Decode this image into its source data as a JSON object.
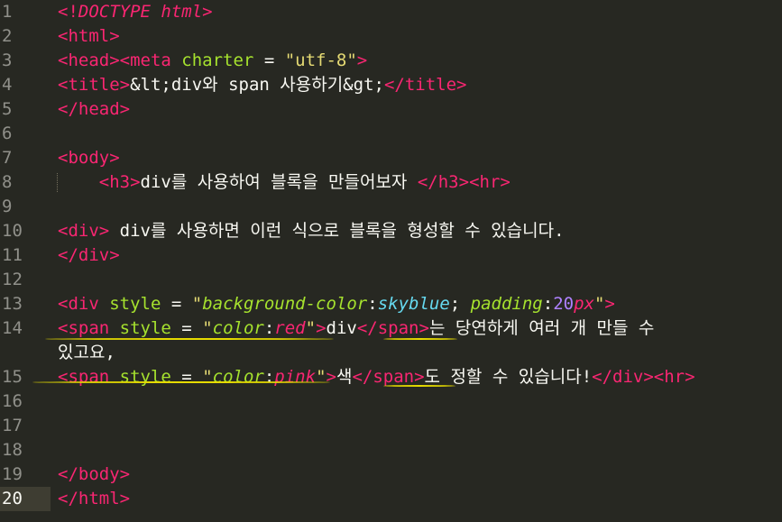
{
  "editor": {
    "current_line": 20,
    "lines": [
      {
        "n": "1",
        "parts": [
          [
            "tag",
            "<!"
          ],
          [
            "doctype",
            "DOCTYPE html"
          ],
          [
            "tag",
            ">"
          ]
        ]
      },
      {
        "n": "2",
        "parts": [
          [
            "tag",
            "<html>"
          ]
        ]
      },
      {
        "n": "3",
        "parts": [
          [
            "tag",
            "<head>"
          ],
          [
            "tag",
            "<meta"
          ],
          [
            "txt",
            " "
          ],
          [
            "attr",
            "charter"
          ],
          [
            "txt",
            " = "
          ],
          [
            "str",
            "\"utf-8\""
          ],
          [
            "tag",
            ">"
          ]
        ]
      },
      {
        "n": "4",
        "parts": [
          [
            "tag",
            "<title>"
          ],
          [
            "txt",
            "&lt;div와 span 사용하기&gt;"
          ],
          [
            "tag",
            "</title>"
          ]
        ]
      },
      {
        "n": "5",
        "parts": [
          [
            "tag",
            "</head>"
          ]
        ]
      },
      {
        "n": "6",
        "parts": []
      },
      {
        "n": "7",
        "parts": [
          [
            "tag",
            "<body>"
          ]
        ]
      },
      {
        "n": "8",
        "parts": [
          [
            "txt",
            "    "
          ],
          [
            "tag",
            "<h3>"
          ],
          [
            "txt",
            "div를 사용하여 블록을 만들어보자 "
          ],
          [
            "tag",
            "</h3>"
          ],
          [
            "tag",
            "<hr>"
          ]
        ]
      },
      {
        "n": "9",
        "parts": []
      },
      {
        "n": "10",
        "parts": [
          [
            "tag",
            "<div>"
          ],
          [
            "txt",
            " div를 사용하면 이런 식으로 블록을 형성할 수 있습니다."
          ]
        ]
      },
      {
        "n": "11",
        "parts": [
          [
            "tag",
            "</div>"
          ]
        ]
      },
      {
        "n": "12",
        "parts": []
      },
      {
        "n": "13",
        "parts": [
          [
            "tag",
            "<div"
          ],
          [
            "txt",
            " "
          ],
          [
            "attr",
            "style"
          ],
          [
            "txt",
            " = "
          ],
          [
            "str",
            "\""
          ],
          [
            "ital",
            "background-color"
          ],
          [
            "txt",
            ":"
          ],
          [
            "ital-kw",
            "skyblue"
          ],
          [
            "txt",
            "; "
          ],
          [
            "ital",
            "padding"
          ],
          [
            "txt",
            ":"
          ],
          [
            "num",
            "20"
          ],
          [
            "ital-tag",
            "px"
          ],
          [
            "str",
            "\""
          ],
          [
            "tag",
            ">"
          ]
        ]
      },
      {
        "n": "14",
        "parts": [
          [
            "tag",
            "<span"
          ],
          [
            "txt",
            " "
          ],
          [
            "attr",
            "style"
          ],
          [
            "txt",
            " = "
          ],
          [
            "str",
            "\""
          ],
          [
            "ital",
            "color"
          ],
          [
            "txt",
            ":"
          ],
          [
            "ital-tag",
            "red"
          ],
          [
            "str",
            "\""
          ],
          [
            "tag",
            ">"
          ],
          [
            "txt",
            "div"
          ],
          [
            "tag",
            "</span>"
          ],
          [
            "txt",
            "는 당연하게 여러 개 만들 수"
          ]
        ],
        "cont": [
          [
            "txt",
            "있고요,"
          ]
        ]
      },
      {
        "n": "15",
        "parts": [
          [
            "tag",
            "<span"
          ],
          [
            "txt",
            " "
          ],
          [
            "attr",
            "style"
          ],
          [
            "txt",
            " = "
          ],
          [
            "str",
            "\""
          ],
          [
            "ital",
            "color"
          ],
          [
            "txt",
            ":"
          ],
          [
            "ital-tag",
            "pink"
          ],
          [
            "str",
            "\""
          ],
          [
            "tag",
            ">"
          ],
          [
            "txt",
            "색"
          ],
          [
            "tag",
            "</span>"
          ],
          [
            "txt",
            "도 정할 수 있습니다!"
          ],
          [
            "tag",
            "</div>"
          ],
          [
            "tag",
            "<hr>"
          ]
        ]
      },
      {
        "n": "16",
        "parts": []
      },
      {
        "n": "17",
        "parts": []
      },
      {
        "n": "18",
        "parts": []
      },
      {
        "n": "19",
        "parts": [
          [
            "tag",
            "</body>"
          ]
        ]
      },
      {
        "n": "20",
        "parts": [
          [
            "tag",
            "</html>"
          ]
        ]
      }
    ]
  },
  "colors": {
    "background": "#272822",
    "tag": "#f92672",
    "attribute": "#a6e22e",
    "string": "#e6db74",
    "number": "#ae81ff",
    "value": "#66d9ef",
    "highlight_underline": "#e6db00"
  }
}
